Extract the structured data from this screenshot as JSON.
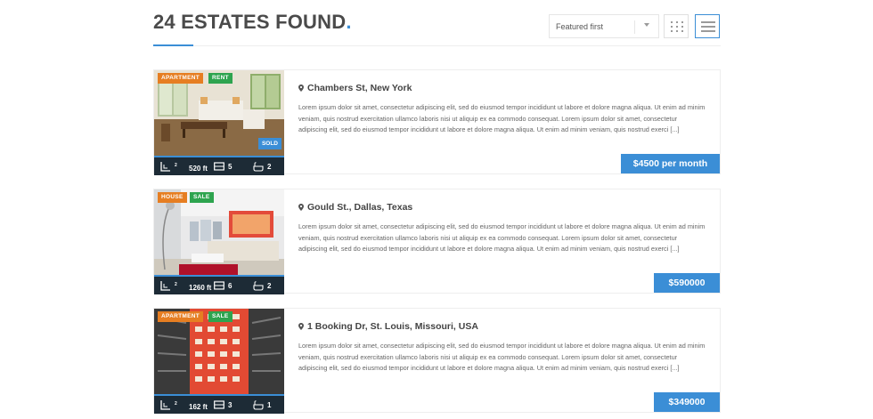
{
  "header": {
    "title": "24 ESTATES FOUND",
    "title_dot": ".",
    "sort": {
      "selected": "Featured first"
    },
    "views": {
      "grid_icon": "grid-icon",
      "list_icon": "list-icon",
      "active": "list"
    }
  },
  "colors": {
    "accent": "#3b8ed6",
    "type_badge": "#e67e22",
    "status_badge": "#2ea44f",
    "stats_bar": "#1d2b36"
  },
  "listings": [
    {
      "type": "APARTMENT",
      "status": "RENT",
      "flag": "SOLD",
      "address": "Chambers St, New York",
      "description": "Lorem ipsum dolor sit amet, consectetur adipiscing elit, sed do eiusmod tempor incididunt ut labore et dolore magna aliqua. Ut enim ad minim veniam, quis nostrud exercitation ullamco laboris nisi ut aliquip ex ea commodo consequat. Lorem ipsum dolor sit amet, consectetur adipiscing elit, sed do eiusmod tempor incididunt ut labore et dolore magna aliqua. Ut enim ad minim veniam, quis nostrud exerci [...]",
      "area": "520 ft",
      "area_unit_sup": "2",
      "bedrooms": "5",
      "bathrooms": "2",
      "price": "$4500 per month"
    },
    {
      "type": "HOUSE",
      "status": "SALE",
      "address": "Gould St., Dallas, Texas",
      "description": "Lorem ipsum dolor sit amet, consectetur adipiscing elit, sed do eiusmod tempor incididunt ut labore et dolore magna aliqua. Ut enim ad minim veniam, quis nostrud exercitation ullamco laboris nisi ut aliquip ex ea commodo consequat. Lorem ipsum dolor sit amet, consectetur adipiscing elit, sed do eiusmod tempor incididunt ut labore et dolore magna aliqua. Ut enim ad minim veniam, quis nostrud exerci [...]",
      "area": "1260 ft",
      "area_unit_sup": "2",
      "bedrooms": "6",
      "bathrooms": "2",
      "price": "$590000"
    },
    {
      "type": "APARTMENT",
      "status": "SALE",
      "address": "1 Booking Dr, St. Louis, Missouri, USA",
      "description": "Lorem ipsum dolor sit amet, consectetur adipiscing elit, sed do eiusmod tempor incididunt ut labore et dolore magna aliqua. Ut enim ad minim veniam, quis nostrud exercitation ullamco laboris nisi ut aliquip ex ea commodo consequat. Lorem ipsum dolor sit amet, consectetur adipiscing elit, sed do eiusmod tempor incididunt ut labore et dolore magna aliqua. Ut enim ad minim veniam, quis nostrud exerci [...]",
      "area": "162 ft",
      "area_unit_sup": "2",
      "bedrooms": "3",
      "bathrooms": "1",
      "price": "$349000"
    }
  ]
}
